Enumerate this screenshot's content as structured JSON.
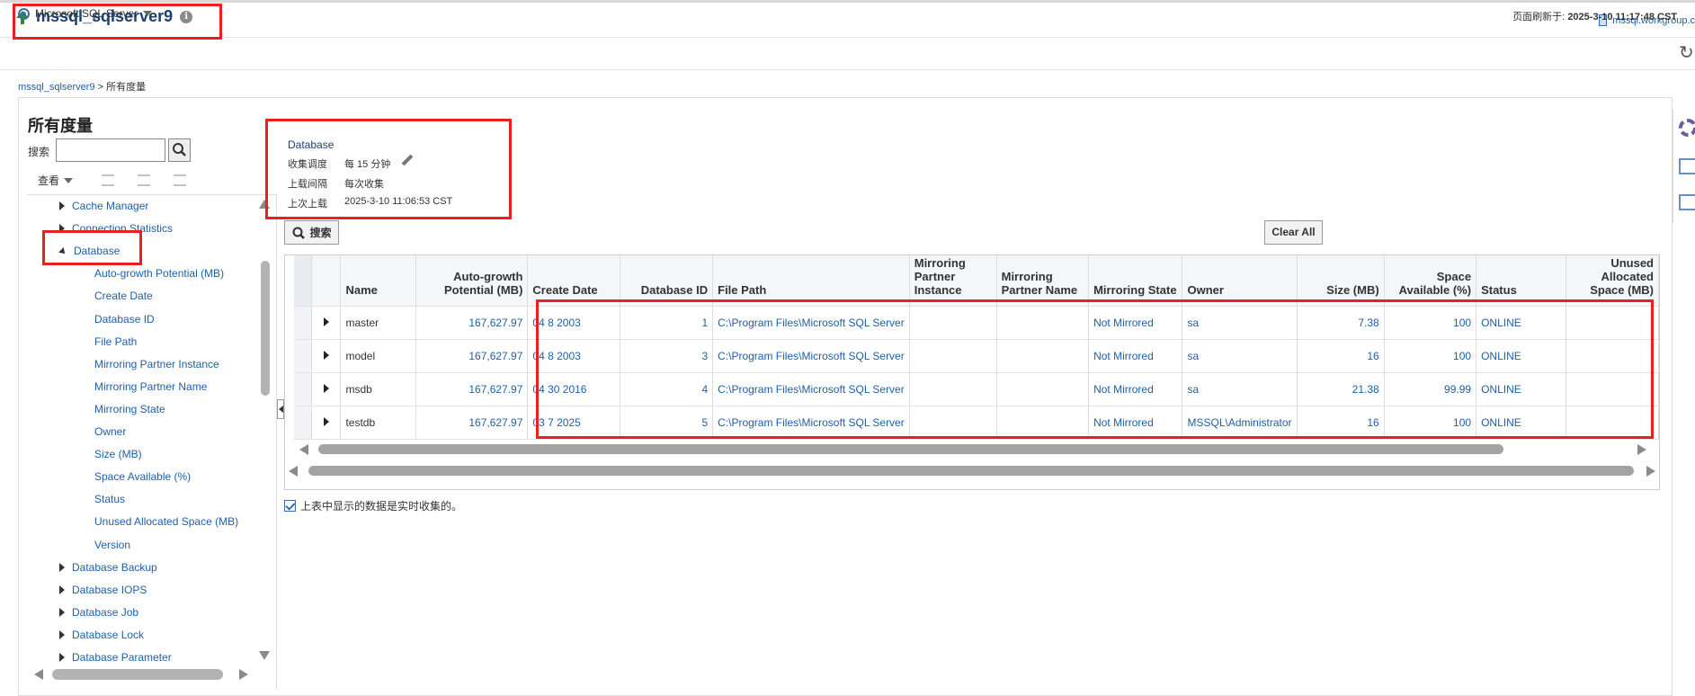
{
  "header": {
    "title": "mssql_sqlserver9",
    "host_link": "mssql.workgroup.c"
  },
  "menubar": {
    "target_menu": "Microsoft SQL Server",
    "refresh_label": "页面刷新于:",
    "refresh_time": "2025-3-10 11:17:48 CST"
  },
  "breadcrumb": {
    "parent": "mssql_sqlserver9",
    "separator": ">",
    "current": "所有度量"
  },
  "left_panel": {
    "title": "所有度量",
    "search_label": "搜索",
    "search_value": "",
    "view_label": "查看",
    "tree": [
      {
        "label": "Cache Manager",
        "level": 0,
        "state": "collapsed"
      },
      {
        "label": "Connection Statistics",
        "level": 0,
        "state": "collapsed"
      },
      {
        "label": "Database",
        "level": 0,
        "state": "expanded"
      },
      {
        "label": "Auto-growth Potential (MB)",
        "level": 1
      },
      {
        "label": "Create Date",
        "level": 1
      },
      {
        "label": "Database ID",
        "level": 1
      },
      {
        "label": "File Path",
        "level": 1
      },
      {
        "label": "Mirroring Partner Instance",
        "level": 1
      },
      {
        "label": "Mirroring Partner Name",
        "level": 1
      },
      {
        "label": "Mirroring State",
        "level": 1
      },
      {
        "label": "Owner",
        "level": 1
      },
      {
        "label": "Size (MB)",
        "level": 1
      },
      {
        "label": "Space Available (%)",
        "level": 1
      },
      {
        "label": "Status",
        "level": 1
      },
      {
        "label": "Unused Allocated Space (MB)",
        "level": 1
      },
      {
        "label": "Version",
        "level": 1
      },
      {
        "label": "Database Backup",
        "level": 0,
        "state": "collapsed"
      },
      {
        "label": "Database IOPS",
        "level": 0,
        "state": "collapsed"
      },
      {
        "label": "Database Job",
        "level": 0,
        "state": "collapsed"
      },
      {
        "label": "Database Lock",
        "level": 0,
        "state": "collapsed"
      },
      {
        "label": "Database Parameter",
        "level": 0,
        "state": "collapsed"
      }
    ]
  },
  "info": {
    "title": "Database",
    "schedule_label": "收集调度",
    "schedule_value": "每 15 分钟",
    "upload_interval_label": "上载间隔",
    "upload_interval_value": "每次收集",
    "last_upload_label": "上次上载",
    "last_upload_value": "2025-3-10 11:06:53 CST"
  },
  "toolbar": {
    "search_button": "搜索",
    "clear_all_button": "Clear All"
  },
  "grid": {
    "columns": [
      "Name",
      "Auto-growth Potential (MB)",
      "Create Date",
      "Database ID",
      "File Path",
      "Mirroring Partner Instance",
      "Mirroring Partner Name",
      "Mirroring State",
      "Owner",
      "Size (MB)",
      "Space Available (%)",
      "Status",
      "Unused Allocated Space (MB)"
    ],
    "rows": [
      {
        "name": "master",
        "autogrowth": "167,627.97",
        "create_date": "04 8 2003",
        "db_id": "1",
        "file_path": "C:\\Program Files\\Microsoft SQL Server",
        "mirror_instance": "",
        "mirror_name": "",
        "mirror_state": "Not Mirrored",
        "owner": "sa",
        "size": "7.38",
        "space_available": "100",
        "status": "ONLINE",
        "unused": ""
      },
      {
        "name": "model",
        "autogrowth": "167,627.97",
        "create_date": "04 8 2003",
        "db_id": "3",
        "file_path": "C:\\Program Files\\Microsoft SQL Server",
        "mirror_instance": "",
        "mirror_name": "",
        "mirror_state": "Not Mirrored",
        "owner": "sa",
        "size": "16",
        "space_available": "100",
        "status": "ONLINE",
        "unused": ""
      },
      {
        "name": "msdb",
        "autogrowth": "167,627.97",
        "create_date": "04 30 2016",
        "db_id": "4",
        "file_path": "C:\\Program Files\\Microsoft SQL Server",
        "mirror_instance": "",
        "mirror_name": "",
        "mirror_state": "Not Mirrored",
        "owner": "sa",
        "size": "21.38",
        "space_available": "99.99",
        "status": "ONLINE",
        "unused": ""
      },
      {
        "name": "testdb",
        "autogrowth": "167,627.97",
        "create_date": "03 7 2025",
        "db_id": "5",
        "file_path": "C:\\Program Files\\Microsoft SQL Server",
        "mirror_instance": "",
        "mirror_name": "",
        "mirror_state": "Not Mirrored",
        "owner": "MSSQL\\Administrator",
        "size": "16",
        "space_available": "100",
        "status": "ONLINE",
        "unused": ""
      }
    ]
  },
  "footer_note": "上表中显示的数据是实时收集的。",
  "colors": {
    "link": "#1f5fa6",
    "title": "#1a3f73",
    "highlight": "#e8201f",
    "status_up": "#2e8b2e"
  },
  "icons": [
    "up-arrow-icon",
    "info-icon",
    "server-icon",
    "target-icon",
    "refresh-icon",
    "search-icon",
    "edit-icon",
    "check-icon",
    "gear-icon"
  ]
}
